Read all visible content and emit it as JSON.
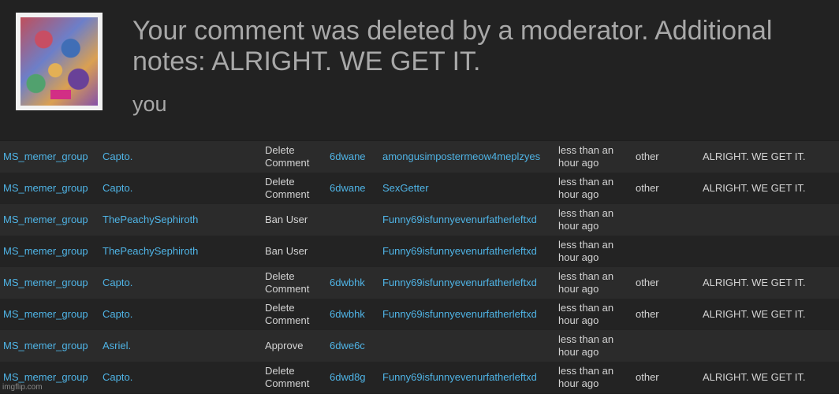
{
  "header": {
    "message": "Your comment was deleted by a moderator. Additional notes: ALRIGHT. WE GET IT.",
    "author": "you"
  },
  "rows": [
    {
      "group": "MS_memer_group",
      "mod": "Capto.",
      "action": "Delete Comment",
      "post": "6dwane",
      "user": "amongusimpostermeow4meplzyes",
      "time": "less than an hour ago",
      "reason": "other",
      "notes": "ALRIGHT. WE GET IT."
    },
    {
      "group": "MS_memer_group",
      "mod": "Capto.",
      "action": "Delete Comment",
      "post": "6dwane",
      "user": "SexGetter",
      "time": "less than an hour ago",
      "reason": "other",
      "notes": "ALRIGHT. WE GET IT."
    },
    {
      "group": "MS_memer_group",
      "mod": "ThePeachySephiroth",
      "action": "Ban User",
      "post": "",
      "user": "Funny69isfunnyevenurfatherleftxd",
      "time": "less than an hour ago",
      "reason": "",
      "notes": ""
    },
    {
      "group": "MS_memer_group",
      "mod": "ThePeachySephiroth",
      "action": "Ban User",
      "post": "",
      "user": "Funny69isfunnyevenurfatherleftxd",
      "time": "less than an hour ago",
      "reason": "",
      "notes": ""
    },
    {
      "group": "MS_memer_group",
      "mod": "Capto.",
      "action": "Delete Comment",
      "post": "6dwbhk",
      "user": "Funny69isfunnyevenurfatherleftxd",
      "time": "less than an hour ago",
      "reason": "other",
      "notes": "ALRIGHT. WE GET IT."
    },
    {
      "group": "MS_memer_group",
      "mod": "Capto.",
      "action": "Delete Comment",
      "post": "6dwbhk",
      "user": "Funny69isfunnyevenurfatherleftxd",
      "time": "less than an hour ago",
      "reason": "other",
      "notes": "ALRIGHT. WE GET IT."
    },
    {
      "group": "MS_memer_group",
      "mod": "Asriel.",
      "action": "Approve",
      "post": "6dwe6c",
      "user": "",
      "time": "less than an hour ago",
      "reason": "",
      "notes": ""
    },
    {
      "group": "MS_memer_group",
      "mod": "Capto.",
      "action": "Delete Comment",
      "post": "6dwd8g",
      "user": "Funny69isfunnyevenurfatherleftxd",
      "time": "less than an hour ago",
      "reason": "other",
      "notes": "ALRIGHT. WE GET IT."
    }
  ],
  "watermark": "imgflip.com",
  "colors": {
    "link": "#4fb4e6",
    "text": "#d4d4d4",
    "muted": "#a8a8a8",
    "background": "#1e1e1e"
  }
}
